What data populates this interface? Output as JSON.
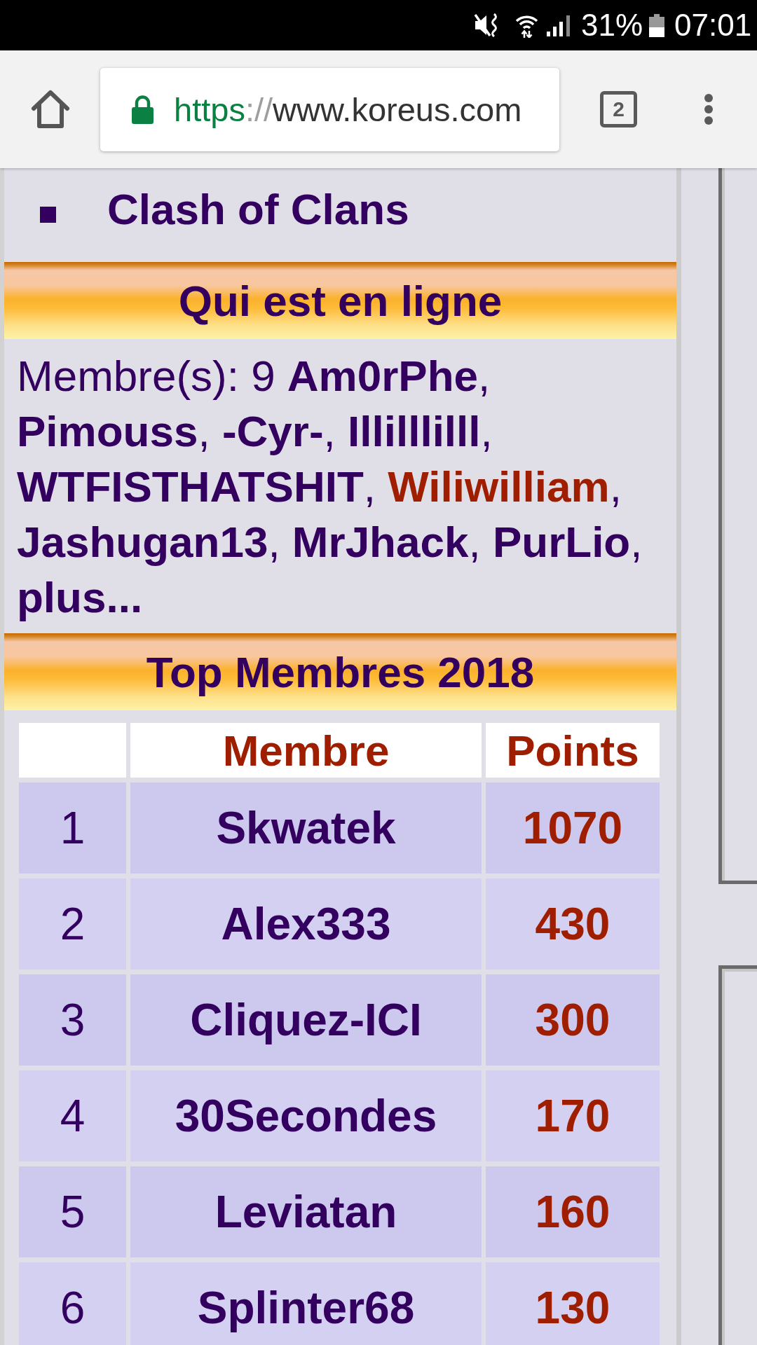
{
  "status_bar": {
    "battery": "31%",
    "time": "07:01"
  },
  "browser": {
    "url": {
      "scheme": "https",
      "separator": "://",
      "host": "www.koreus.com"
    },
    "tab_count": "2"
  },
  "games_list": {
    "items": [
      "Clash of Clans"
    ]
  },
  "online": {
    "title": "Qui est en ligne",
    "label": "Membre(s): 9",
    "members": [
      {
        "name": "Am0rPhe",
        "color": "#34005f",
        "trail": ","
      },
      {
        "name": "Pimouss",
        "color": "#34005f",
        "trail": ","
      },
      {
        "name": "-Cyr-",
        "color": "#34005f",
        "trail": ","
      },
      {
        "name": "Illilllilll",
        "color": "#34005f",
        "trail": ","
      },
      {
        "name": "WTFISTHATSHIT",
        "color": "#34005f",
        "trail": ","
      },
      {
        "name": "Wiliwilliam",
        "color": "#a01e00",
        "trail": ","
      },
      {
        "name": "Jashugan13",
        "color": "#34005f",
        "trail": ","
      },
      {
        "name": "MrJhack",
        "color": "#34005f",
        "trail": ","
      },
      {
        "name": "PurLio",
        "color": "#34005f",
        "trail": ","
      }
    ],
    "more": "plus..."
  },
  "top_members": {
    "title": "Top Membres 2018",
    "columns": [
      "Membre",
      "Points"
    ],
    "rows": [
      {
        "rank": "1",
        "member": "Skwatek",
        "points": "1070"
      },
      {
        "rank": "2",
        "member": "Alex333",
        "points": "430"
      },
      {
        "rank": "3",
        "member": "Cliquez-ICI",
        "points": "300"
      },
      {
        "rank": "4",
        "member": "30Secondes",
        "points": "170"
      },
      {
        "rank": "5",
        "member": "Leviatan",
        "points": "160"
      },
      {
        "rank": "6",
        "member": "Splinter68",
        "points": "130"
      }
    ]
  }
}
